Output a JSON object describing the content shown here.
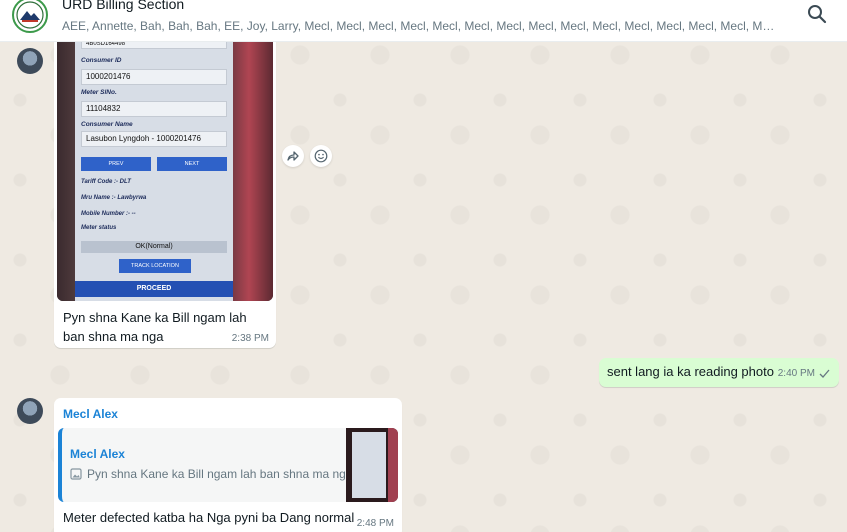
{
  "header": {
    "title": "URD Billing Section",
    "members": "AEE, Annette, Bah, Bah, Bah, EE, Joy, Larry, Mecl, Mecl, Mecl, Mecl, Mecl, Mecl, Mecl, Mecl, Mecl, Mecl, Mecl, Mecl, Mecl, Mecl, Mecl, Mecl, ..."
  },
  "messages": {
    "image_message": {
      "phone_screen": {
        "top_field": "4B0SD164498",
        "consumer_id_label": "Consumer ID",
        "consumer_id": "1000201476",
        "meter_slno_label": "Meter SlNo.",
        "meter_slno": "11104832",
        "consumer_name_label": "Consumer Name",
        "consumer_name": "Lasubon Lyngdoh - 1000201476",
        "prev_label": "PREV",
        "next_label": "NEXT",
        "tariff_code": "Tariff Code :- DLT",
        "mru_name": "Mru Name :- Lawbyrwa",
        "mobile_number": "Mobile Number :- --",
        "meter_status_label": "Meter status",
        "meter_status_value": "OK(Normal)",
        "track_location_label": "TRACK LOCATION",
        "proceed_label": "PROCEED"
      },
      "caption": "Pyn shna Kane ka Bill ngam lah ban shna ma nga",
      "time": "2:38 PM"
    },
    "outgoing": {
      "text": "sent lang ia ka reading photo",
      "time": "2:40 PM"
    },
    "reply_message": {
      "sender": "Mecl Alex",
      "quoted_sender": "Mecl Alex",
      "quoted_text": "Pyn shna Kane ka Bill ngam lah ban shna ma nga",
      "text": "Meter defected katba ha Nga pyni ba Dang normal",
      "time": "2:48 PM"
    }
  },
  "colors": {
    "chat_background": "#efeae2",
    "outgoing_bubble": "#d9fdd3",
    "sender_name": "#1b83d6"
  },
  "icons": [
    "search-icon",
    "forward-icon",
    "emoji-icon",
    "image-icon",
    "double-check-icon"
  ]
}
